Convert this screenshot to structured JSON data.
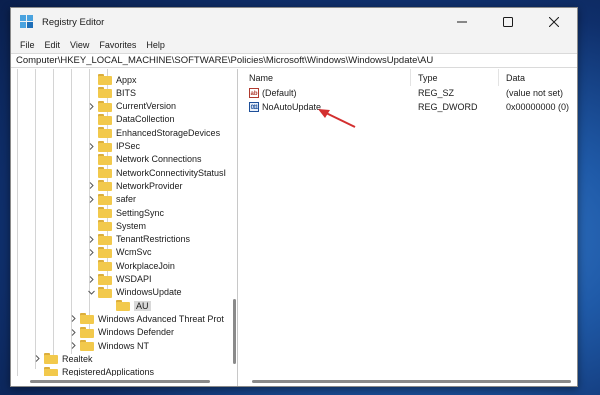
{
  "window": {
    "title": "Registry Editor"
  },
  "menu": [
    "File",
    "Edit",
    "View",
    "Favorites",
    "Help"
  ],
  "address": "Computer\\HKEY_LOCAL_MACHINE\\SOFTWARE\\Policies\\Microsoft\\Windows\\WindowsUpdate\\AU",
  "tree": {
    "items": [
      {
        "label": "Appx"
      },
      {
        "label": "BITS"
      },
      {
        "label": "CurrentVersion"
      },
      {
        "label": "DataCollection"
      },
      {
        "label": "EnhancedStorageDevices"
      },
      {
        "label": "IPSec"
      },
      {
        "label": "Network Connections"
      },
      {
        "label": "NetworkConnectivityStatusI"
      },
      {
        "label": "NetworkProvider"
      },
      {
        "label": "safer"
      },
      {
        "label": "SettingSync"
      },
      {
        "label": "System"
      },
      {
        "label": "TenantRestrictions"
      },
      {
        "label": "WcmSvc"
      },
      {
        "label": "WorkplaceJoin"
      },
      {
        "label": "WSDAPI"
      },
      {
        "label": "WindowsUpdate"
      },
      {
        "label": "AU"
      },
      {
        "label": "Windows Advanced Threat Prot"
      },
      {
        "label": "Windows Defender"
      },
      {
        "label": "Windows NT"
      },
      {
        "label": "Realtek"
      },
      {
        "label": "RegisteredApplications"
      }
    ]
  },
  "list": {
    "columns": [
      "Name",
      "Type",
      "Data"
    ],
    "rows": [
      {
        "name": "(Default)",
        "type": "REG_SZ",
        "data": "(value not set)",
        "icon": "string-value-icon"
      },
      {
        "name": "NoAutoUpdate",
        "type": "REG_DWORD",
        "data": "0x00000000 (0)",
        "icon": "dword-value-icon"
      }
    ]
  },
  "colors": {
    "annotation_arrow": "#d32f2f",
    "selection": "#d9d9d9",
    "folder": "#f2c94c"
  }
}
